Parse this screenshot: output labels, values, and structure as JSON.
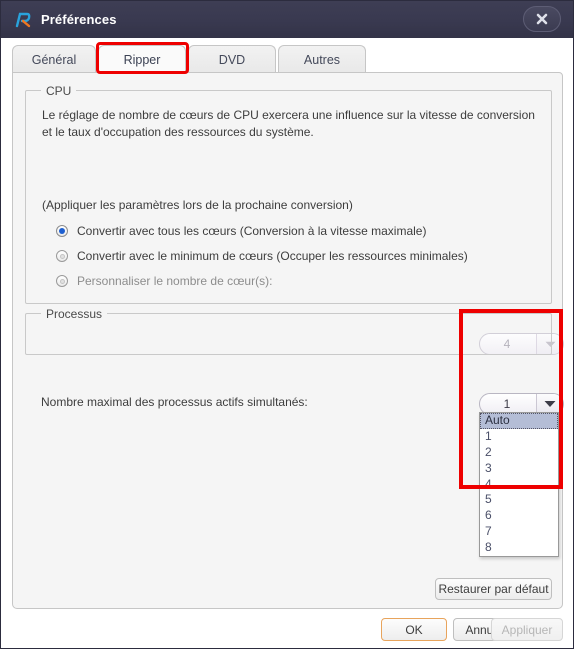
{
  "window": {
    "title": "Préférences",
    "logo_icon": "app-logo-icon",
    "close_icon": "close-icon"
  },
  "tabs": [
    {
      "label": "Général",
      "name": "tab-general",
      "active": false
    },
    {
      "label": "Ripper",
      "name": "tab-ripper",
      "active": true
    },
    {
      "label": "DVD",
      "name": "tab-dvd",
      "active": false
    },
    {
      "label": "Autres",
      "name": "tab-autres",
      "active": false
    }
  ],
  "cpu_group": {
    "legend": "CPU",
    "description": "Le réglage de nombre de cœurs de CPU exercera une influence sur la vitesse de conversion et le taux d'occupation des ressources du système.",
    "apply_note": "(Appliquer les paramètres lors de la prochaine conversion)",
    "options": [
      {
        "label": "Convertir avec tous les cœurs (Conversion à la vitesse maximale)",
        "checked": true
      },
      {
        "label": "Convertir avec le minimum de cœurs (Occuper les ressources minimales)",
        "checked": false
      },
      {
        "label": "Personnaliser le nombre de cœur(s):",
        "checked": false
      }
    ],
    "cores_combo": {
      "value": "4",
      "enabled": false,
      "arrow_icon": "chevron-down-icon"
    }
  },
  "processus_group": {
    "legend": "Processus",
    "label": "Nombre maximal des processus actifs simultanés:",
    "combo": {
      "value": "1",
      "arrow_icon": "chevron-down-icon",
      "expanded": true,
      "options": [
        "Auto",
        "1",
        "2",
        "3",
        "4",
        "5",
        "6",
        "7",
        "8"
      ],
      "highlighted_option": "Auto"
    }
  },
  "buttons": {
    "restore_defaults": "Restaurer par défaut",
    "ok": "OK",
    "cancel": "Annuler",
    "apply": "Appliquer"
  },
  "annotations": {
    "accent_color": "#ee0000",
    "highlight_tab": "Ripper",
    "highlight_control": "processus-combo"
  }
}
